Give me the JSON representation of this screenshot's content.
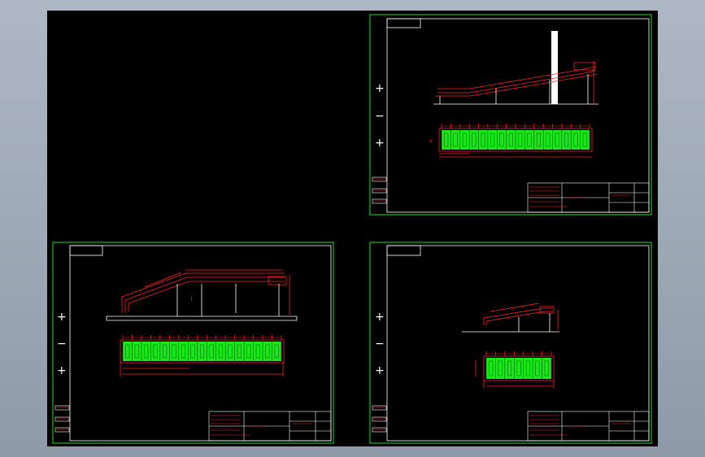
{
  "viewer": {
    "background_color": "#000000",
    "frame_color": "#1fe01f",
    "line_color": "#ff2020",
    "fill_color": "#18e818"
  },
  "sheets": [
    {
      "id": "top-right"
    },
    {
      "id": "bottom-left"
    },
    {
      "id": "bottom-right"
    }
  ],
  "markers": [
    "+",
    "−",
    "+"
  ]
}
